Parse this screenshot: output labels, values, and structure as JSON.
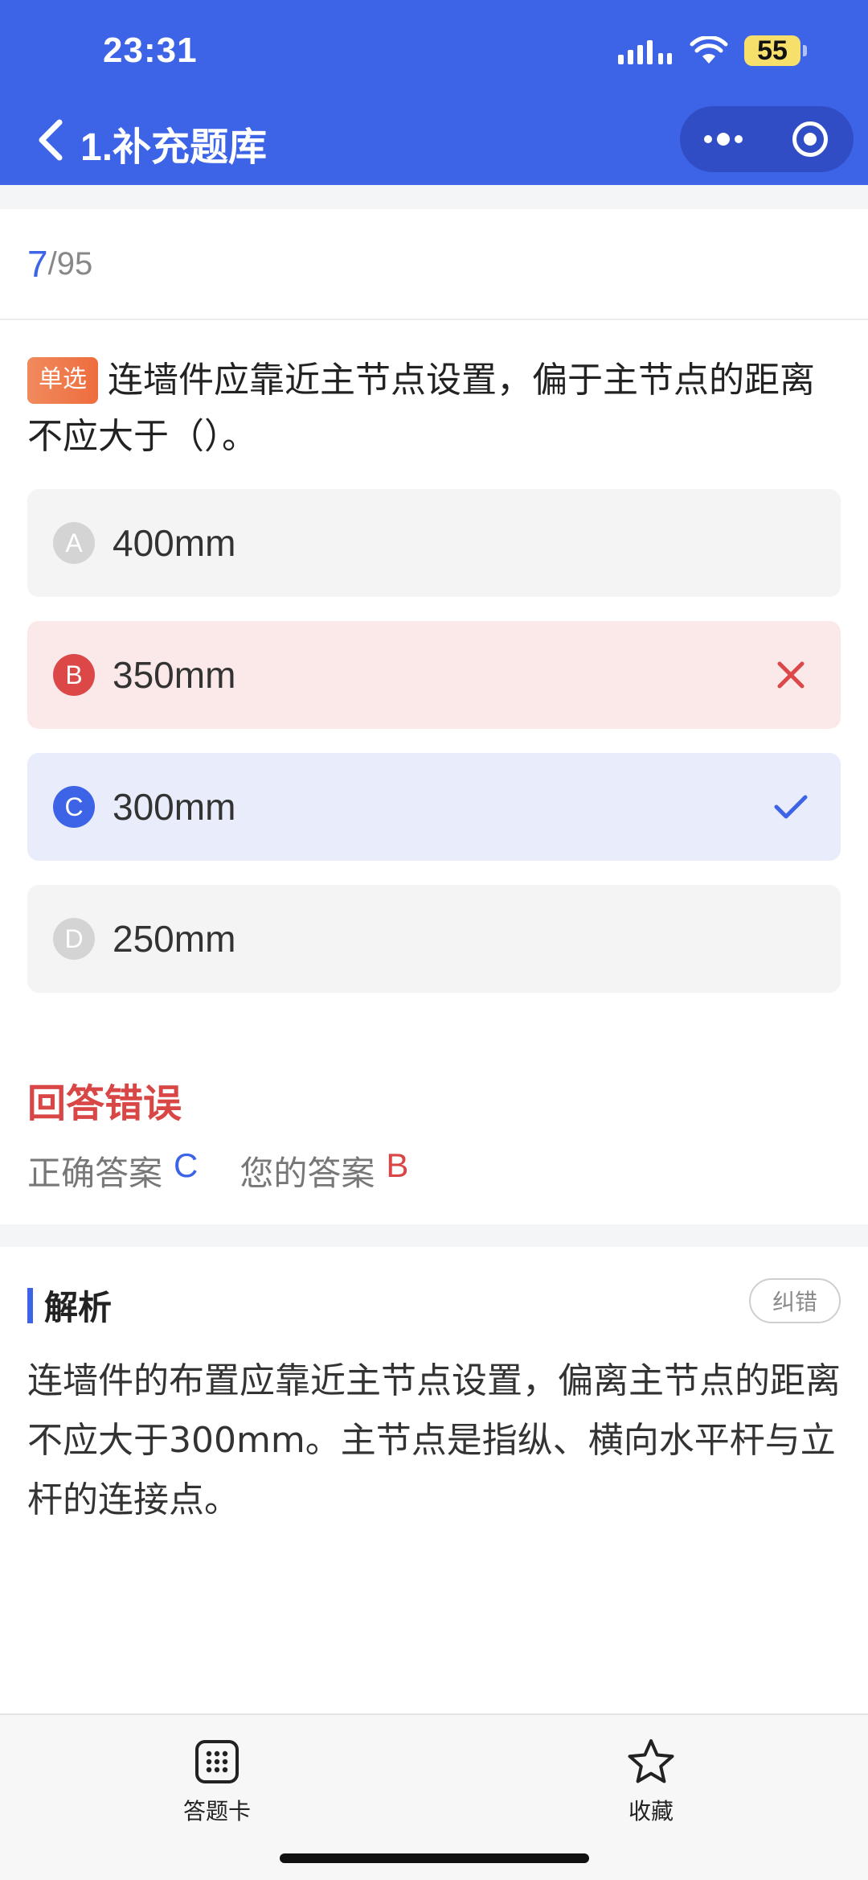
{
  "status_bar": {
    "time": "23:31",
    "battery": "55"
  },
  "nav": {
    "title": "1.补充题库",
    "icons": {
      "back": "chevron-left-icon",
      "more": "more-dots-icon",
      "close": "target-icon"
    }
  },
  "progress": {
    "current": "7",
    "total": "/95"
  },
  "question": {
    "tag": "单选",
    "text": "连墙件应靠近主节点设置，偏于主节点的距离不应大于（）。",
    "options": [
      {
        "letter": "A",
        "text": "400mm",
        "state": "normal"
      },
      {
        "letter": "B",
        "text": "350mm",
        "state": "wrong"
      },
      {
        "letter": "C",
        "text": "300mm",
        "state": "correct"
      },
      {
        "letter": "D",
        "text": "250mm",
        "state": "normal"
      }
    ]
  },
  "result": {
    "title": "回答错误",
    "correct_label": "正确答案",
    "correct_value": "C",
    "yours_label": "您的答案",
    "yours_value": "B"
  },
  "analysis": {
    "title": "解析",
    "report_label": "纠错",
    "text": "连墙件的布置应靠近主节点设置，偏离主节点的距离不应大于300mm。主节点是指纵、横向水平杆与立杆的连接点。"
  },
  "tabbar": {
    "items": [
      {
        "label": "答题卡",
        "icon": "grid-icon"
      },
      {
        "label": "收藏",
        "icon": "star-icon"
      }
    ]
  },
  "colors": {
    "primary": "#3d63e6",
    "wrong": "#dc4848",
    "wrong_bg": "#fbe9e9",
    "correct_bg": "#e8ecfb",
    "tag": "#ee6d3e"
  }
}
